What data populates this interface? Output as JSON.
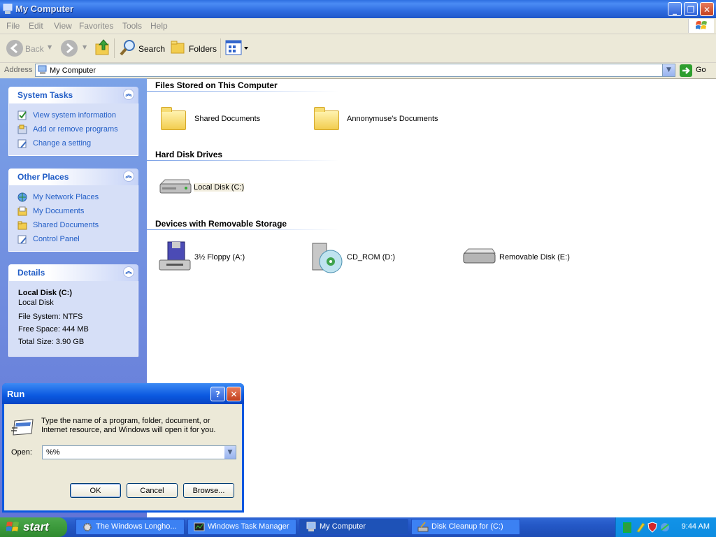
{
  "window": {
    "title": "My Computer"
  },
  "menu": [
    "File",
    "Edit",
    "View",
    "Favorites",
    "Tools",
    "Help"
  ],
  "toolbar": {
    "back": "Back",
    "search": "Search",
    "folders": "Folders"
  },
  "address": {
    "label": "Address",
    "value": "My Computer",
    "go": "Go"
  },
  "sidebar": {
    "system_tasks": {
      "title": "System Tasks",
      "items": [
        "View system information",
        "Add or remove programs",
        "Change a setting"
      ]
    },
    "other_places": {
      "title": "Other Places",
      "items": [
        "My Network Places",
        "My Documents",
        "Shared Documents",
        "Control Panel"
      ]
    },
    "details": {
      "title": "Details",
      "name": "Local Disk (C:)",
      "type": "Local Disk",
      "file_system": "File System: NTFS",
      "free_space": "Free Space: 444 MB",
      "total_size": "Total Size: 3.90 GB"
    }
  },
  "content": {
    "groups": [
      {
        "title": "Files Stored on This Computer",
        "items": [
          "Shared Documents",
          "Annonymuse's Documents"
        ]
      },
      {
        "title": "Hard Disk Drives",
        "items": [
          "Local Disk (C:)"
        ]
      },
      {
        "title": "Devices with Removable Storage",
        "items": [
          "3½ Floppy (A:)",
          "CD_ROM (D:)",
          "Removable Disk (E:)"
        ]
      }
    ]
  },
  "run_dialog": {
    "title": "Run",
    "description": "Type the name of a program, folder, document, or Internet resource, and Windows will open it for you.",
    "open_label": "Open:",
    "open_value": "%%",
    "ok": "OK",
    "cancel": "Cancel",
    "browse": "Browse..."
  },
  "taskbar": {
    "start": "start",
    "tasks": [
      "The Windows Longho...",
      "Windows Task Manager",
      "My Computer",
      "Disk Cleanup for  (C:)"
    ],
    "clock": "9:44 AM"
  },
  "colors": {
    "xp_blue": "#0a58e0",
    "link_blue": "#215dc6",
    "start_green": "#3c9a3c",
    "sidebar_blue": "#7ba2e7"
  }
}
